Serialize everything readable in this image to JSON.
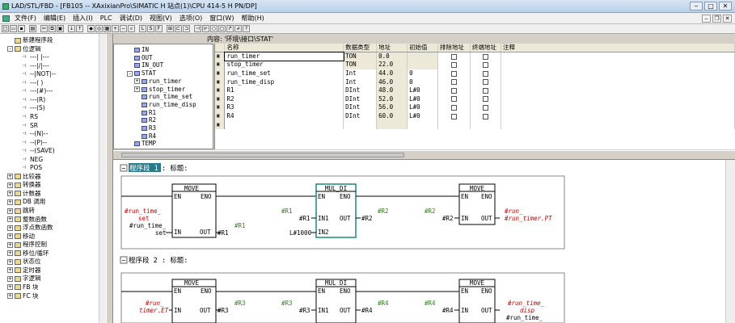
{
  "window": {
    "title": "LAD/STL/FBD - [FB105 -- XAxixianPro\\SIMATIC H 站点(1)\\CPU 414-5 H PN/DP]"
  },
  "menu": [
    "文件(F)",
    "编辑(E)",
    "插入(I)",
    "PLC",
    "调试(D)",
    "视图(V)",
    "选项(O)",
    "窗口(W)",
    "帮助(H)"
  ],
  "left_tree": [
    {
      "label": "新建程序段",
      "level": 0,
      "exp": "",
      "icon": "new-network-icon"
    },
    {
      "label": "位逻辑",
      "level": 0,
      "exp": "-",
      "icon": "folder-icon"
    },
    {
      "label": "---| |---",
      "level": 1,
      "icon": "contact-no-icon"
    },
    {
      "label": "---|/|---",
      "level": 1,
      "icon": "contact-nc-icon"
    },
    {
      "label": "--|NOT|--",
      "level": 1,
      "icon": "not-icon"
    },
    {
      "label": "---( )",
      "level": 1,
      "icon": "coil-icon"
    },
    {
      "label": "---(#)---",
      "level": 1,
      "icon": "midline-coil-icon"
    },
    {
      "label": "---(R)",
      "level": 1,
      "icon": "reset-coil-icon"
    },
    {
      "label": "---(S)",
      "level": 1,
      "icon": "set-coil-icon"
    },
    {
      "label": "RS",
      "level": 1,
      "icon": "rs-icon"
    },
    {
      "label": "SR",
      "level": 1,
      "icon": "sr-icon"
    },
    {
      "label": "--(N)--",
      "level": 1,
      "icon": "neg-edge-icon"
    },
    {
      "label": "--(P)--",
      "level": 1,
      "icon": "pos-edge-icon"
    },
    {
      "label": "--(SAVE)",
      "level": 1,
      "icon": "save-coil-icon"
    },
    {
      "label": "NEG",
      "level": 1,
      "icon": "neg-icon"
    },
    {
      "label": "POS",
      "level": 1,
      "icon": "pos-icon"
    },
    {
      "label": "比较器",
      "level": 0,
      "exp": "+",
      "icon": "folder-icon"
    },
    {
      "label": "转换器",
      "level": 0,
      "exp": "+",
      "icon": "folder-icon"
    },
    {
      "label": "计数器",
      "level": 0,
      "exp": "+",
      "icon": "folder-icon"
    },
    {
      "label": "DB 调用",
      "level": 0,
      "exp": "+",
      "icon": "folder-icon"
    },
    {
      "label": "跳转",
      "level": 0,
      "exp": "+",
      "icon": "folder-icon"
    },
    {
      "label": "整数函数",
      "level": 0,
      "exp": "+",
      "icon": "folder-icon"
    },
    {
      "label": "浮点数函数",
      "level": 0,
      "exp": "+",
      "icon": "folder-icon"
    },
    {
      "label": "移动",
      "level": 0,
      "exp": "+",
      "icon": "folder-icon"
    },
    {
      "label": "程序控制",
      "level": 0,
      "exp": "+",
      "icon": "folder-icon"
    },
    {
      "label": "移位/循环",
      "level": 0,
      "exp": "+",
      "icon": "folder-icon"
    },
    {
      "label": "状态位",
      "level": 0,
      "exp": "+",
      "icon": "folder-icon"
    },
    {
      "label": "定时器",
      "level": 0,
      "exp": "+",
      "icon": "folder-icon"
    },
    {
      "label": "字逻辑",
      "level": 0,
      "exp": "+",
      "icon": "folder-icon"
    },
    {
      "label": "FB 块",
      "level": 0,
      "exp": "+",
      "icon": "folder-icon"
    },
    {
      "label": "FC 块",
      "level": 0,
      "exp": "+",
      "icon": "folder-icon"
    }
  ],
  "content_label": "内容: '环境\\接口\\STAT'",
  "interface_tree": [
    {
      "label": "IN",
      "indent": 1,
      "exp": ""
    },
    {
      "label": "OUT",
      "indent": 1,
      "exp": ""
    },
    {
      "label": "IN_OUT",
      "indent": 1,
      "exp": ""
    },
    {
      "label": "STAT",
      "indent": 0,
      "exp": "-"
    },
    {
      "label": "run_timer",
      "indent": 1,
      "exp": "+"
    },
    {
      "label": "stop_timer",
      "indent": 1,
      "exp": "+"
    },
    {
      "label": "run_time_set",
      "indent": 2,
      "exp": ""
    },
    {
      "label": "run_time_disp",
      "indent": 2,
      "exp": ""
    },
    {
      "label": "R1",
      "indent": 2,
      "exp": ""
    },
    {
      "label": "R2",
      "indent": 2,
      "exp": ""
    },
    {
      "label": "R3",
      "indent": 2,
      "exp": ""
    },
    {
      "label": "R4",
      "indent": 2,
      "exp": ""
    },
    {
      "label": "TEMP",
      "indent": 1,
      "exp": ""
    }
  ],
  "var_table": {
    "headers": [
      "名称",
      "数据类型",
      "地址",
      "初始值",
      "排除地址",
      "终端地址",
      "注释"
    ],
    "rows": [
      {
        "name": "run_timer",
        "type": "TON",
        "addr": "0.0",
        "init": "",
        "ro": true
      },
      {
        "name": "stop_timer",
        "type": "TON",
        "addr": "22.0",
        "init": "",
        "ro": true
      },
      {
        "name": "run_time_set",
        "type": "Int",
        "addr": "44.0",
        "init": "0",
        "ro": false
      },
      {
        "name": "run_time_disp",
        "type": "Int",
        "addr": "46.0",
        "init": "0",
        "ro": false
      },
      {
        "name": "R1",
        "type": "DInt",
        "addr": "48.0",
        "init": "L#0",
        "ro": false
      },
      {
        "name": "R2",
        "type": "DInt",
        "addr": "52.0",
        "init": "L#0",
        "ro": false
      },
      {
        "name": "R3",
        "type": "DInt",
        "addr": "56.0",
        "init": "L#0",
        "ro": false
      },
      {
        "name": "R4",
        "type": "DInt",
        "addr": "60.0",
        "init": "L#0",
        "ro": false
      },
      {
        "name": "",
        "type": "",
        "addr": "",
        "init": "",
        "ro": false
      }
    ]
  },
  "networks": [
    {
      "title_a": "程序段 1",
      "title_b": ": 标题:"
    },
    {
      "title_a": "程序段 2",
      "title_b": ": 标题:"
    }
  ],
  "ladder": {
    "move": "MOVE",
    "mul": "MUL_DI",
    "en": "EN",
    "eno": "ENO",
    "in": "IN",
    "out": "OUT",
    "in1": "IN1",
    "in2": "IN2",
    "n1_in_top": "#run_time_",
    "n1_in_top2": "set",
    "n1_in_lbl": "#run_time_",
    "n1_in_lbl2": "set",
    "n1_out": "#R1",
    "n1_r1_red": "#R1",
    "n1_mul_in1": "#R1",
    "n1_mul_in2": "L#1000",
    "n1_mul_out": "#R2",
    "n1_r2_red": "#R2",
    "n1_r2_red2": "#R2",
    "n1_mv3_in": "#R2",
    "n1_mv3_top": "#run_timer.PT",
    "n1_mv3_top_a": "#run_",
    "n2_in_top": "#run_",
    "n2_in_top2": "timer.ET",
    "n2_in": "#run_timer.ET",
    "n2_out": "#R3",
    "n2_r3_red": "#R3",
    "n2_mul_in1": "#R3",
    "n2_mul_out": "#R4",
    "n2_r4_red": "#R4",
    "n2_r4_red2": "#R4",
    "n2_mv3_in": "#R4",
    "n2_mv3_top": "#run_time_",
    "n2_mv3_top2": "disp",
    "n2_mv3_out": "#run_time_"
  },
  "colors": {
    "red_label": "#c00000",
    "green_label": "#3a7a2a",
    "highlight_box": "#1a8a7a",
    "network_title_bg": "#2a7a8a"
  }
}
